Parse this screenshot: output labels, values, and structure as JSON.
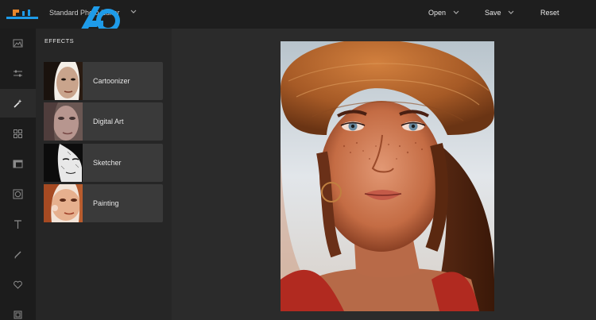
{
  "app": {
    "title": "Standard Photo Editor"
  },
  "topbar": {
    "open_label": "Open",
    "save_label": "Save",
    "reset_label": "Reset"
  },
  "sidebar_tools": [
    {
      "icon": "image-icon"
    },
    {
      "icon": "sliders-icon"
    },
    {
      "icon": "magic-wand-icon",
      "active": true
    },
    {
      "icon": "grid-icon"
    },
    {
      "icon": "frame-icon"
    },
    {
      "icon": "vignette-icon"
    },
    {
      "icon": "text-icon"
    },
    {
      "icon": "brush-icon"
    },
    {
      "icon": "heart-icon"
    },
    {
      "icon": "layers-icon"
    }
  ],
  "effects_panel": {
    "title": "EFFECTS",
    "items": [
      {
        "label": "Cartoonizer"
      },
      {
        "label": "Digital Art"
      },
      {
        "label": "Sketcher"
      },
      {
        "label": "Painting"
      }
    ]
  },
  "colors": {
    "topbar_bg": "#1e1e1e",
    "rail_bg": "#1c1c1c",
    "panel_bg": "#262626",
    "item_bg": "#3a3a3a",
    "canvas_bg": "#2b2b2b",
    "accent_orange": "#e8862a",
    "watermark_blue": "#1e9be9"
  }
}
